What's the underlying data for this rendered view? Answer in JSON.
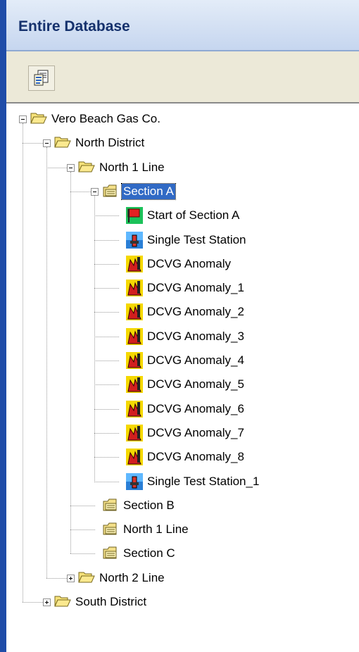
{
  "panel": {
    "title": "Entire Database"
  },
  "toolbar": {
    "icon": "report-icon"
  },
  "tree": [
    {
      "label": "Vero Beach Gas Co.",
      "level": 0,
      "icon": "folder-open",
      "expander": "minus"
    },
    {
      "label": "North District",
      "level": 1,
      "icon": "folder-open",
      "expander": "minus"
    },
    {
      "label": "North 1 Line",
      "level": 2,
      "icon": "folder-open",
      "expander": "minus"
    },
    {
      "label": "Section A",
      "level": 3,
      "icon": "section-folder",
      "expander": "minus",
      "selected": true
    },
    {
      "label": "Start of Section A",
      "level": 4,
      "icon": "start-flag"
    },
    {
      "label": "Single Test Station",
      "level": 4,
      "icon": "test-station"
    },
    {
      "label": "DCVG Anomaly",
      "level": 4,
      "icon": "dcvg-anomaly"
    },
    {
      "label": "DCVG Anomaly_1",
      "level": 4,
      "icon": "dcvg-anomaly"
    },
    {
      "label": "DCVG Anomaly_2",
      "level": 4,
      "icon": "dcvg-anomaly"
    },
    {
      "label": "DCVG Anomaly_3",
      "level": 4,
      "icon": "dcvg-anomaly"
    },
    {
      "label": "DCVG Anomaly_4",
      "level": 4,
      "icon": "dcvg-anomaly"
    },
    {
      "label": "DCVG Anomaly_5",
      "level": 4,
      "icon": "dcvg-anomaly"
    },
    {
      "label": "DCVG Anomaly_6",
      "level": 4,
      "icon": "dcvg-anomaly"
    },
    {
      "label": "DCVG Anomaly_7",
      "level": 4,
      "icon": "dcvg-anomaly"
    },
    {
      "label": "DCVG Anomaly_8",
      "level": 4,
      "icon": "dcvg-anomaly"
    },
    {
      "label": "Single Test Station_1",
      "level": 4,
      "icon": "test-station"
    },
    {
      "label": "Section B",
      "level": 3,
      "icon": "section-folder"
    },
    {
      "label": "North 1 Line",
      "level": 3,
      "icon": "section-folder"
    },
    {
      "label": "Section C",
      "level": 3,
      "icon": "section-folder"
    },
    {
      "label": "North 2 Line",
      "level": 2,
      "icon": "folder-open",
      "expander": "plus"
    },
    {
      "label": "South District",
      "level": 1,
      "icon": "folder-open",
      "expander": "plus"
    }
  ]
}
